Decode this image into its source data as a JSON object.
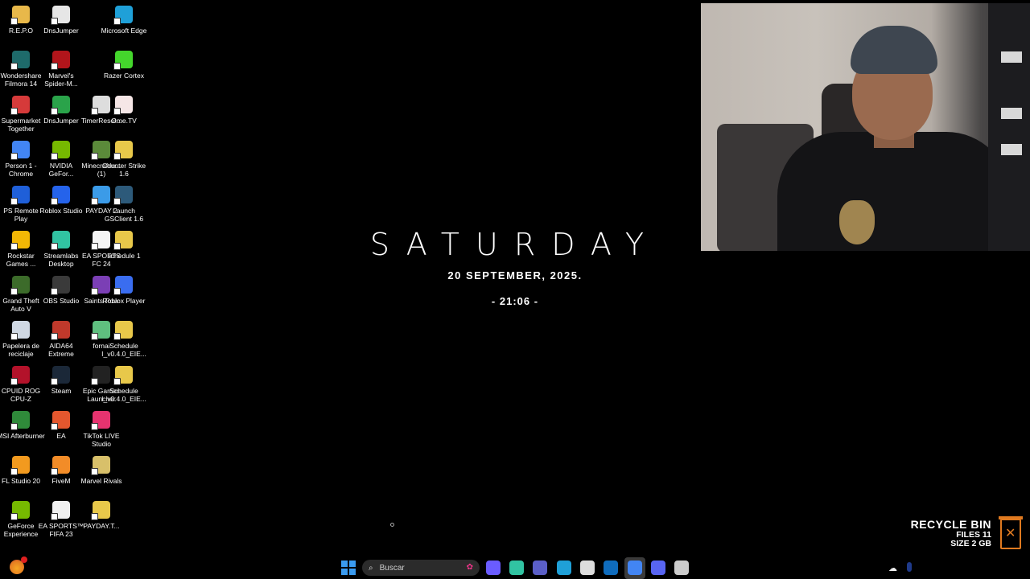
{
  "desktop": {
    "column1": [
      {
        "label": "R.E.P.O",
        "icon": "folder-icon",
        "color": "#e8b84a"
      },
      {
        "label": "Wondershare Filmora 14",
        "icon": "filmora-icon",
        "color": "#1e6b6b"
      },
      {
        "label": "Supermarket Together",
        "icon": "supermarket-icon",
        "color": "#d63a3a"
      },
      {
        "label": "Person 1 - Chrome",
        "icon": "chrome-icon",
        "color": "#4285f4"
      },
      {
        "label": "PS Remote Play",
        "icon": "ps-remote-icon",
        "color": "#1f5fd8"
      },
      {
        "label": "Rockstar Games ...",
        "icon": "rockstar-icon",
        "color": "#f2b705"
      },
      {
        "label": "Grand Theft Auto V",
        "icon": "gta-icon",
        "color": "#3c6b2a"
      },
      {
        "label": "Papelera de reciclaje",
        "icon": "recycle-bin-icon",
        "color": "#cfd8e3"
      },
      {
        "label": "CPUID ROG CPU-Z",
        "icon": "cpuz-icon",
        "color": "#b3122a"
      },
      {
        "label": "MSI Afterburner",
        "icon": "afterburner-icon",
        "color": "#2f8a3a"
      },
      {
        "label": "FL Studio 20",
        "icon": "flstudio-icon",
        "color": "#f29a1f"
      },
      {
        "label": "GeForce Experience",
        "icon": "geforce-icon",
        "color": "#76b900"
      }
    ],
    "column2": [
      {
        "label": "DnsJumper",
        "icon": "file-icon",
        "color": "#e6e6e6"
      },
      {
        "label": "Marvel's Spider-M...",
        "icon": "spiderman-icon",
        "color": "#b2151b"
      },
      {
        "label": "DnsJumper",
        "icon": "dnsjumper-icon",
        "color": "#2aa34a"
      },
      {
        "label": "NVIDIA GeFor...",
        "icon": "nvidia-icon",
        "color": "#76b900"
      },
      {
        "label": "Roblox Studio",
        "icon": "roblox-studio-icon",
        "color": "#2563eb"
      },
      {
        "label": "Streamlabs Desktop",
        "icon": "streamlabs-icon",
        "color": "#31c3a2"
      },
      {
        "label": "OBS Studio",
        "icon": "obs-icon",
        "color": "#3a3a3a"
      },
      {
        "label": "AIDA64 Extreme",
        "icon": "aida64-icon",
        "color": "#c0392b"
      },
      {
        "label": "Steam",
        "icon": "steam-icon",
        "color": "#1b2838"
      },
      {
        "label": "EA",
        "icon": "ea-icon",
        "color": "#e4572e"
      },
      {
        "label": "FiveM",
        "icon": "fivem-icon",
        "color": "#f28c28"
      },
      {
        "label": "EA SPORTS™ FIFA 23",
        "icon": "fifa-icon",
        "color": "#f0f0f0"
      }
    ],
    "column3": [
      {
        "label": "TimerResol...",
        "icon": "timer-icon",
        "color": "#dddddd"
      },
      {
        "label": "MinecraftIn... (1)",
        "icon": "minecraft-icon",
        "color": "#5b8a3a"
      },
      {
        "label": "PAYDAY 2",
        "icon": "payday-icon",
        "color": "#3b9be8"
      },
      {
        "label": "EA SPORTS FC 24",
        "icon": "fc24-icon",
        "color": "#f5f5f5"
      },
      {
        "label": "Saints Row",
        "icon": "saints-row-icon",
        "color": "#7b3fb5"
      },
      {
        "label": "fornai",
        "icon": "file-icon",
        "color": "#5fbf7f"
      },
      {
        "label": "Epic Games Launcher",
        "icon": "epic-icon",
        "color": "#222222"
      },
      {
        "label": "TikTok LIVE Studio",
        "icon": "tiktok-icon",
        "color": "#e6336f"
      },
      {
        "label": "Marvel Rivals",
        "icon": "marvel-rivals-icon",
        "color": "#d8c06a"
      },
      {
        "label": "PAYDAY.T...",
        "icon": "folder-icon",
        "color": "#e8c84a"
      }
    ],
    "column4": [
      {
        "label": "Microsoft Edge",
        "icon": "edge-icon",
        "color": "#1fa0d8"
      },
      {
        "label": "Razer Cortex",
        "icon": "razer-icon",
        "color": "#44d62c"
      },
      {
        "label": "Ome.TV",
        "icon": "ometv-icon",
        "color": "#f5e6e6"
      },
      {
        "label": "Counter Strike 1.6",
        "icon": "folder-icon",
        "color": "#e8c84a"
      },
      {
        "label": "Launch GSClient 1.6",
        "icon": "cs-icon",
        "color": "#2d5a7a"
      },
      {
        "label": "schedule 1",
        "icon": "folder-icon",
        "color": "#e8c84a"
      },
      {
        "label": "Roblox Player",
        "icon": "roblox-icon",
        "color": "#3a6df0"
      },
      {
        "label": "Schedule I_v0.4.0_EIE...",
        "icon": "folder-icon",
        "color": "#e8c84a"
      },
      {
        "label": "Schedule I_v0.4.0_EIE...",
        "icon": "folder-icon",
        "color": "#e8c84a"
      }
    ]
  },
  "clock": {
    "day": "SATURDAY",
    "date": "20 SEPTEMBER, 2025.",
    "time": "- 21:06 -"
  },
  "recycle_widget": {
    "title": "RECYCLE BIN",
    "files": "FILES 11",
    "size": "SIZE 2 GB"
  },
  "taskbar": {
    "search_placeholder": "Buscar",
    "apps": [
      {
        "name": "copilot-icon",
        "color": "#6a5cff"
      },
      {
        "name": "streamlabs-taskbar-icon",
        "color": "#31c3a2"
      },
      {
        "name": "teams-icon",
        "color": "#5b5fc7"
      },
      {
        "name": "edge-taskbar-icon",
        "color": "#1fa0d8"
      },
      {
        "name": "call-of-duty-icon",
        "color": "#dddddd"
      },
      {
        "name": "outlook-icon",
        "color": "#0f6cbd"
      },
      {
        "name": "chrome-taskbar-icon",
        "color": "#4285f4"
      },
      {
        "name": "discord-icon",
        "color": "#5865f2"
      },
      {
        "name": "obs-taskbar-icon",
        "color": "#cccccc"
      }
    ]
  }
}
